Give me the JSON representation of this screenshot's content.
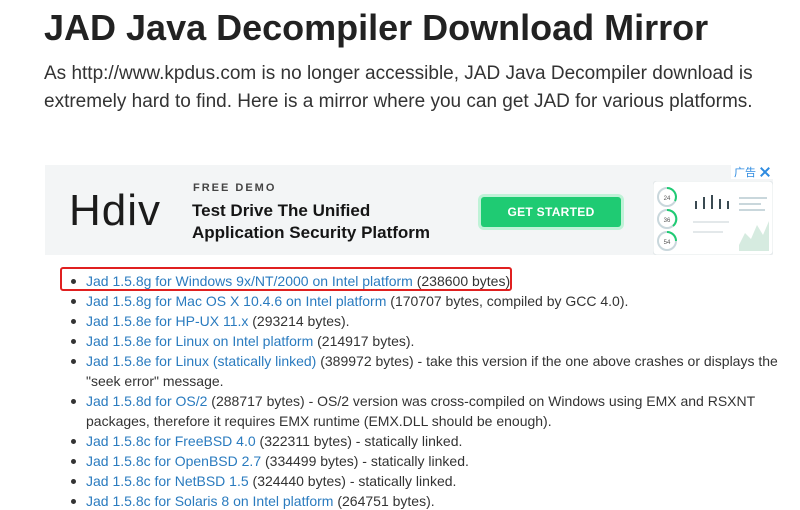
{
  "page": {
    "title": "JAD Java Decompiler Download Mirror",
    "intro": "As http://www.kpdus.com is no longer accessible, JAD Java Decompiler download is extremely hard to find. Here is a mirror where you can get JAD for various platforms."
  },
  "ad": {
    "adchoice_label": "广告",
    "logo": "Hdiv",
    "eyebrow": "FREE DEMO",
    "headline_line1": "Test Drive The Unified",
    "headline_line2": "Application Security Platform",
    "cta": "GET STARTED",
    "gauge_values": [
      "24",
      "36",
      "54"
    ],
    "colors": {
      "cta_green": "#1fcb73",
      "background": "#f3f5f6"
    }
  },
  "downloads": [
    {
      "link": "Jad 1.5.8g for Windows 9x/NT/2000 on Intel platform",
      "desc": " (238600 bytes)"
    },
    {
      "link": "Jad 1.5.8g for Mac OS X 10.4.6 on Intel platform",
      "desc": " (170707 bytes, compiled by GCC 4.0)."
    },
    {
      "link": "Jad 1.5.8e for HP-UX 11.x",
      "desc": " (293214 bytes)."
    },
    {
      "link": "Jad 1.5.8e for Linux on Intel platform",
      "desc": " (214917 bytes)."
    },
    {
      "link": "Jad 1.5.8e for Linux (statically linked)",
      "desc": " (389972 bytes) - take this version if the one above crashes or displays the \"seek error\" message."
    },
    {
      "link": "Jad 1.5.8d for OS/2",
      "desc": " (288717 bytes) - OS/2 version was cross-compiled on Windows using EMX and RSXNT packages, therefore it requires EMX runtime (EMX.DLL should be enough)."
    },
    {
      "link": "Jad 1.5.8c for FreeBSD 4.0",
      "desc": " (322311 bytes) - statically linked."
    },
    {
      "link": "Jad 1.5.8c for OpenBSD 2.7",
      "desc": " (334499 bytes) - statically linked."
    },
    {
      "link": "Jad 1.5.8c for NetBSD 1.5",
      "desc": " (324440 bytes) - statically linked."
    },
    {
      "link": "Jad 1.5.8c for Solaris 8 on Intel platform",
      "desc": " (264751 bytes)."
    }
  ],
  "colors": {
    "link": "#2a7bbf",
    "highlight": "#e02020"
  }
}
